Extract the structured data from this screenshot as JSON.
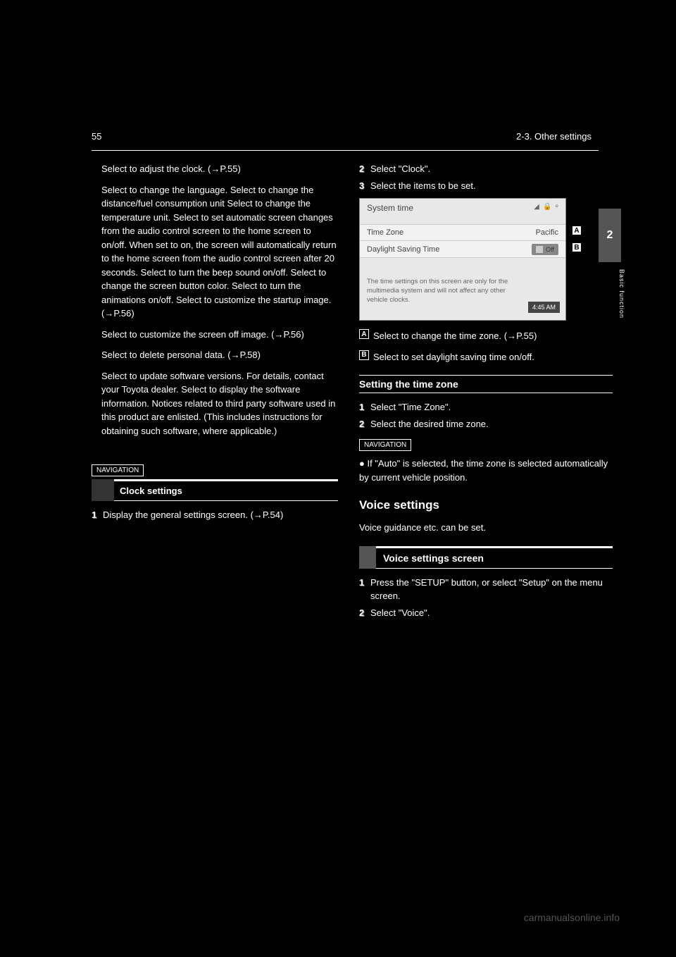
{
  "header": {
    "page_number": "55",
    "section": "2-3. Other settings"
  },
  "tab": {
    "number": "2",
    "label": "Basic function"
  },
  "left_column": {
    "p1": "Select to adjust the clock.",
    "p1_ref": "(→P.55)",
    "p2": "Select to change the language. Select to change the distance/fuel consumption unit Select to change the temperature unit. Select to set automatic screen changes from the audio control screen to the home screen to on/off. When set to on, the screen will automatically return to the home screen from the audio control screen after 20 seconds. Select to turn the beep sound on/off. Select to change the screen button color. Select to turn the animations on/off. Select to customize the startup image.",
    "p2_ref": "(→P.56)",
    "p3": "Select to customize the screen off image.",
    "p3_ref": "(→P.56)",
    "p4": "Select to delete personal data.",
    "p4_ref": "(→P.58)",
    "p5": "Select to update software versions. For details, contact your Toyota dealer. Select to display the software information. Notices related to third party software used in this product are enlisted. (This includes instructions for obtaining such software, where applicable.)",
    "nav_label": "NAVIGATION",
    "nav_box_title": "Clock settings",
    "step1": "Display the general settings screen.",
    "step1_ref": "(→P.54)"
  },
  "right_column": {
    "step2": "Select \"Clock\".",
    "step3": "Select the items to be set.",
    "screenshot": {
      "title": "System time",
      "row1_label": "Time Zone",
      "row1_value": "Pacific",
      "row2_label": "Daylight Saving Time",
      "row2_value": "Off",
      "note": "The time settings on this screen are only for the multimedia system and will not affect any other vehicle clocks.",
      "clock": "4:45 AM"
    },
    "callout_a": "Select to change the time zone.",
    "callout_a_ref": "(→P.55)",
    "callout_b": "Select to set daylight saving time on/off.",
    "sub1_title": "Setting the time zone",
    "sub1_step1": "Select \"Time Zone\".",
    "sub1_step2": "Select the desired time zone.",
    "nav_label": "NAVIGATION",
    "sub1_note": "If \"Auto\" is selected, the time zone is selected automatically by current vehicle position.",
    "voice_heading": "Voice settings",
    "voice_bar": "Voice settings screen",
    "voice_intro": "Voice guidance etc. can be set.",
    "voice_step1": "Press the \"SETUP\" button, or select \"Setup\" on the menu screen.",
    "voice_step2": "Select \"Voice\"."
  },
  "watermark": "carmanualsonline.info"
}
